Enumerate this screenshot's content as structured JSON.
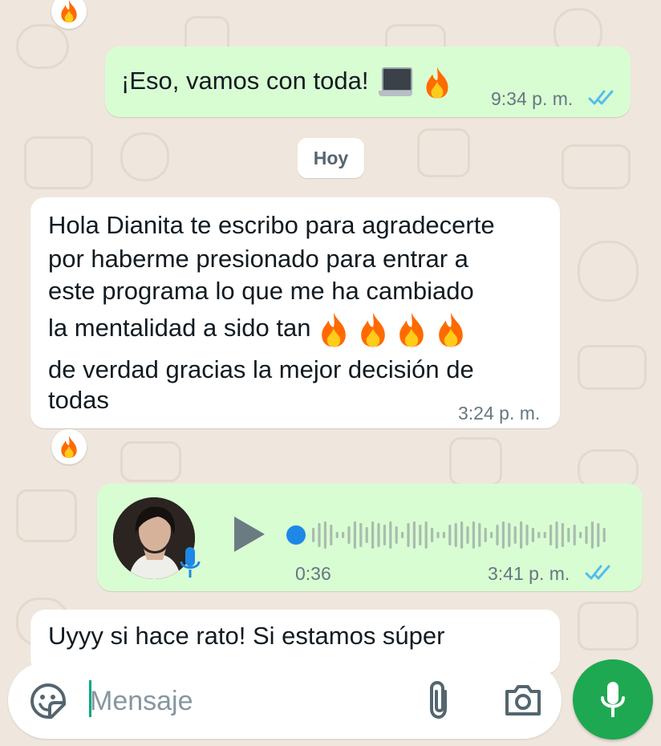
{
  "chat": {
    "msg1": {
      "text": "¡Eso, vamos con toda!",
      "time": "9:34 p. m.",
      "status": "read"
    },
    "date_chip": "Hoy",
    "msg2": {
      "lines": [
        "Hola Dianita te escribo para agradecerte",
        "por haberme presionado para entrar a",
        "este programa lo que me ha cambiado",
        "la mentalidad a sido tan",
        "de verdad gracias la mejor decisión de",
        "todas"
      ],
      "time": "3:24 p. m."
    },
    "voice": {
      "duration": "0:36",
      "time": "3:41 p. m.",
      "status": "read",
      "progress": 0
    },
    "msg3": {
      "text": "Uyyy si hace rato! Si estamos súper"
    },
    "reaction_emoji": "fire"
  },
  "composer": {
    "placeholder": "Mensaje"
  },
  "icons": {
    "emoji_button": "sticker-smiley-icon",
    "attach_button": "paperclip-icon",
    "camera_button": "camera-icon",
    "send_button": "microphone-icon",
    "play_button": "play-icon"
  },
  "colors": {
    "outgoing_bubble": "#d9fdd3",
    "incoming_bubble": "#ffffff",
    "read_ticks": "#53bdeb",
    "accent_green": "#1ea852",
    "background": "#efe7dd"
  }
}
